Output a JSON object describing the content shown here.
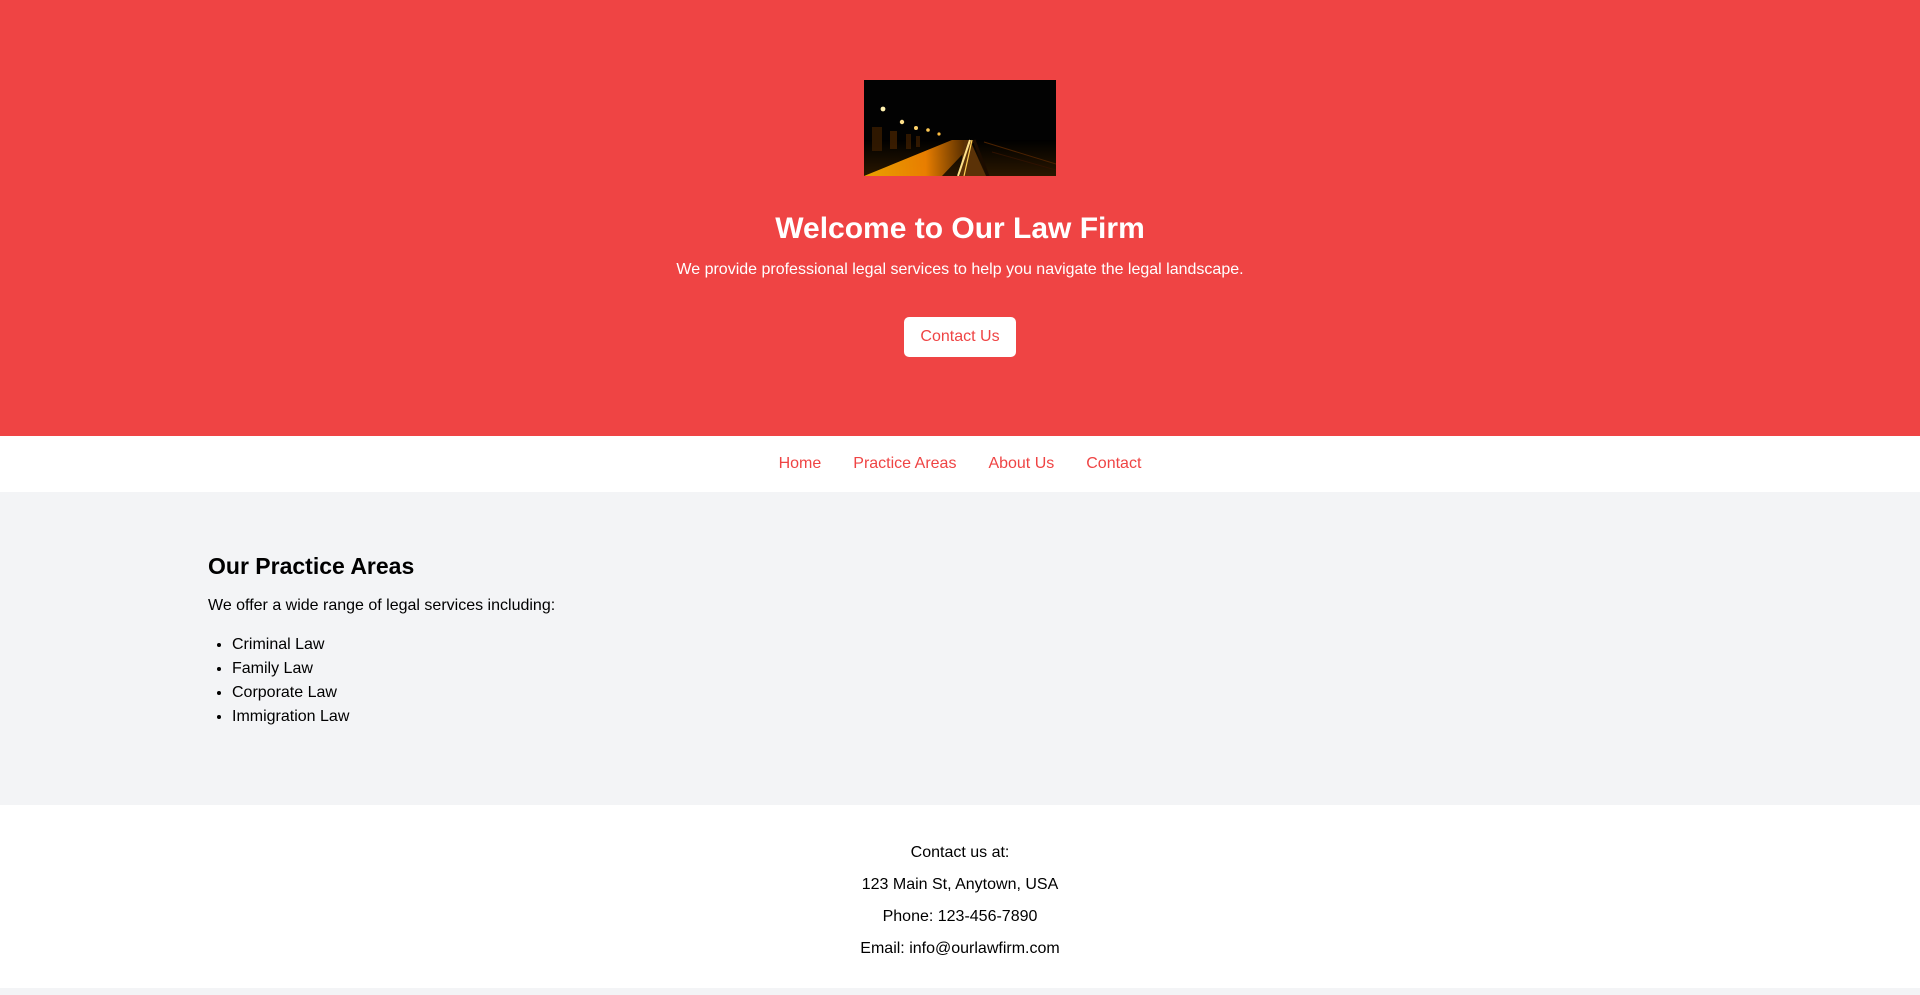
{
  "hero": {
    "image_alt": "Night road with street lights",
    "title": "Welcome to Our Law Firm",
    "subtitle": "We provide professional legal services to help you navigate the legal landscape.",
    "button_label": "Contact Us"
  },
  "nav": {
    "items": [
      {
        "label": "Home"
      },
      {
        "label": "Practice Areas"
      },
      {
        "label": "About Us"
      },
      {
        "label": "Contact"
      }
    ]
  },
  "practice": {
    "title": "Our Practice Areas",
    "intro": "We offer a wide range of legal services including:",
    "items": [
      "Criminal Law",
      "Family Law",
      "Corporate Law",
      "Immigration Law"
    ]
  },
  "footer": {
    "heading": "Contact us at:",
    "address": "123 Main St, Anytown, USA",
    "phone": "Phone: 123-456-7890",
    "email": "Email: info@ourlawfirm.com"
  },
  "colors": {
    "accent": "#ef4444",
    "background": "#f3f4f6",
    "surface": "#ffffff"
  }
}
